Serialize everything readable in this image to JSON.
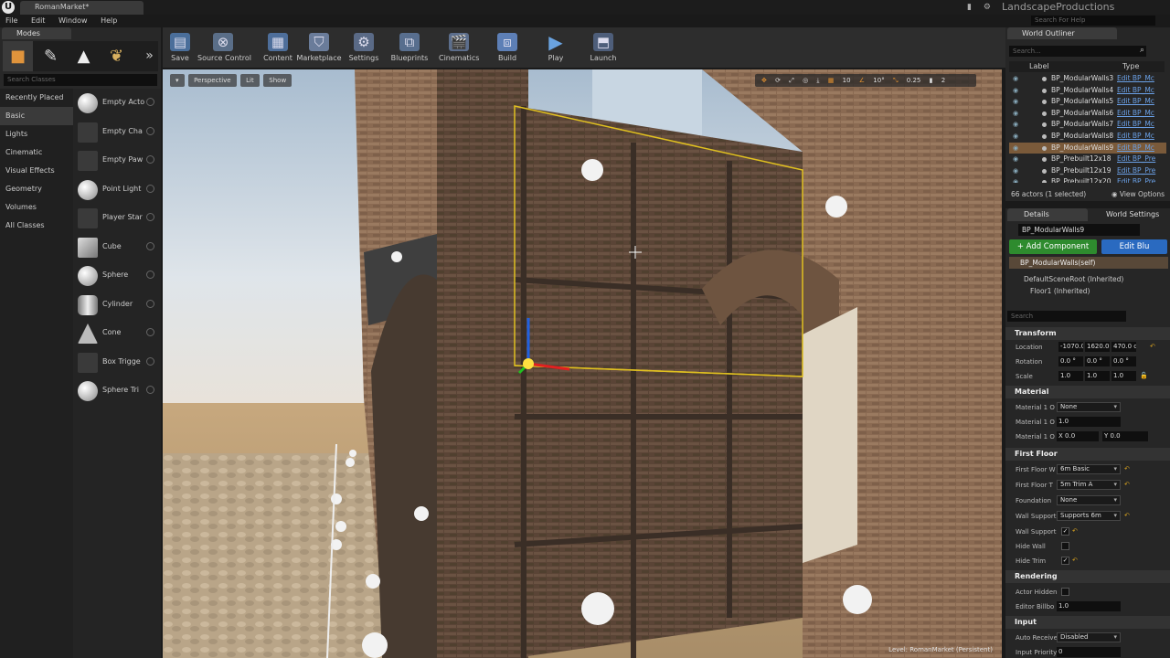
{
  "app": {
    "logo": "U",
    "doc_tab": "RomanMarket*",
    "project": "LandscapeProductions",
    "help_search": "Search For Help"
  },
  "menu": [
    "File",
    "Edit",
    "Window",
    "Help"
  ],
  "modes": {
    "tab": "Modes",
    "search_placeholder": "Search Classes",
    "categories": [
      "Recently Placed",
      "Basic",
      "Lights",
      "Cinematic",
      "Visual Effects",
      "Geometry",
      "Volumes",
      "All Classes"
    ],
    "items": [
      "Empty Acto",
      "Empty Cha",
      "Empty Paw",
      "Point Light",
      "Player Star",
      "Cube",
      "Sphere",
      "Cylinder",
      "Cone",
      "Box Trigge",
      "Sphere Tri"
    ]
  },
  "toolbar": [
    "Save",
    "Source Control",
    "Content",
    "Marketplace",
    "Settings",
    "Blueprints",
    "Cinematics",
    "Build",
    "Play",
    "Launch"
  ],
  "viewport": {
    "perspective": "Perspective",
    "lit": "Lit",
    "show": "Show",
    "grid_snap": "10",
    "rot_snap": "10°",
    "scale_snap": "0.25",
    "cam_speed": "2",
    "level": "Level:  RomanMarket (Persistent)"
  },
  "outliner": {
    "tab": "World Outliner",
    "search_placeholder": "Search...",
    "col_label": "Label",
    "col_type": "Type",
    "rows": [
      {
        "name": "BP_ModularWalls3",
        "type": "Edit BP_Mc"
      },
      {
        "name": "BP_ModularWalls4",
        "type": "Edit BP_Mc"
      },
      {
        "name": "BP_ModularWalls5",
        "type": "Edit BP_Mc"
      },
      {
        "name": "BP_ModularWalls6",
        "type": "Edit BP_Mc"
      },
      {
        "name": "BP_ModularWalls7",
        "type": "Edit BP_Mc"
      },
      {
        "name": "BP_ModularWalls8",
        "type": "Edit BP_Mc"
      },
      {
        "name": "BP_ModularWalls9",
        "type": "Edit BP_Mc"
      },
      {
        "name": "BP_Prebuilt12x18",
        "type": "Edit BP_Pre"
      },
      {
        "name": "BP_Prebuilt12x19",
        "type": "Edit BP_Pre"
      },
      {
        "name": "BP_Prebuilt12x20",
        "type": "Edit BP_Pre"
      }
    ],
    "selected_index": 6,
    "actor_count": "66 actors (1 selected)",
    "view_options": "View Options"
  },
  "details": {
    "tab": "Details",
    "world_settings_tab": "World Settings",
    "name": "BP_ModularWalls9",
    "add_component": "+ Add Component",
    "edit_blueprint": "Edit Blu",
    "self_comp": "BP_ModularWalls(self)",
    "root_comp": "DefaultSceneRoot (Inherited)",
    "floor_comp": "Floor1 (Inherited)",
    "search_placeholder": "Search",
    "transform": {
      "title": "Transform",
      "location_label": "Location",
      "location": [
        "-1070.0",
        "1620.0",
        "470.0 c"
      ],
      "rotation_label": "Rotation",
      "rotation": [
        "0.0 °",
        "0.0 °",
        "0.0 °"
      ],
      "scale_label": "Scale",
      "scale": [
        "1.0",
        "1.0",
        "1.0"
      ]
    },
    "material": {
      "title": "Material",
      "p1_label": "Material 1 O",
      "p1_value": "None",
      "p2_label": "Material 1 O",
      "p2_value": "1.0",
      "p3_label": "Material 1 O",
      "p3_x": "X 0.0",
      "p3_y": "Y 0.0"
    },
    "first_floor": {
      "title": "First Floor",
      "p1_label": "First Floor W",
      "p1_value": "6m Basic",
      "p2_label": "First Floor T",
      "p2_value": "5m Trim A",
      "p3_label": "Foundation",
      "p3_value": "None",
      "p4_label": "Wall Support",
      "p4_value": "Supports 6m",
      "p5_label": "Wall Support",
      "p6_label": "Hide Wall",
      "p7_label": "Hide Trim"
    },
    "rendering": {
      "title": "Rendering",
      "p1_label": "Actor Hidden",
      "p2_label": "Editor Billbo",
      "p2_value": "1.0"
    },
    "input": {
      "title": "Input",
      "p1_label": "Auto Receive",
      "p1_value": "Disabled",
      "p2_label": "Input Priority",
      "p2_value": "0"
    }
  }
}
